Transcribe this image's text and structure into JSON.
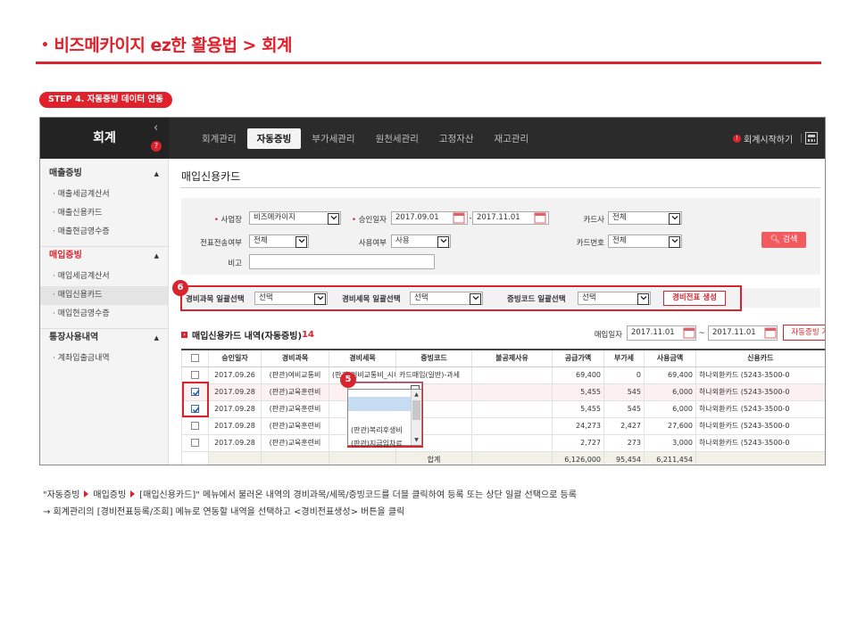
{
  "page": {
    "title": "비즈메카이지 ez한 활용법 > 회계",
    "bullet": "•",
    "step": "STEP 4.  자동증빙 데이터 연동"
  },
  "app": {
    "brand": "회계",
    "menu": [
      "회계관리",
      "자동증빙",
      "부가세관리",
      "원천세관리",
      "고정자산",
      "재고관리"
    ],
    "active_menu": 1,
    "start_label": "회계시작하기"
  },
  "sidebar": {
    "groups": [
      {
        "title": "매출증빙",
        "items": [
          "매출세금계산서",
          "매출신용카드",
          "매출현금영수증"
        ]
      },
      {
        "title": "매입증빙",
        "items": [
          "매입세금계산서",
          "매입신용카드",
          "매입현금영수증"
        ]
      },
      {
        "title": "통장사용내역",
        "items": [
          "계좌입출금내역"
        ]
      }
    ],
    "active_group": 1,
    "active_item": "매입신용카드"
  },
  "main": {
    "title": "매입신용카드",
    "filter": {
      "business_label": "사업장",
      "business_value": "비즈메카이지",
      "approval_label": "승인일자",
      "approval_from": "2017.09.01",
      "approval_to": "2017.11.01",
      "tilde": "-",
      "card_co_label": "카드사",
      "card_co_value": "전체",
      "transfer_label": "전표전송여부",
      "transfer_value": "전체",
      "use_label": "사용여부",
      "use_value": "사용",
      "card_no_label": "카드번호",
      "card_no_value": "전체",
      "memo_label": "비고",
      "memo_value": "",
      "search_button": "검색"
    },
    "bulk": {
      "account_label": "경비과목 일괄선택",
      "account_value": "선택",
      "detail_label": "경비세목 일괄선택",
      "detail_value": "선택",
      "evidence_label": "증빙코드 일괄선택",
      "evidence_value": "선택",
      "create_button": "경비전표 생성"
    },
    "list": {
      "title": "매입신용카드 내역(자동증빙)",
      "count": "14",
      "date_label": "매입일자",
      "date_from": "2017.11.01",
      "date_to": "2017.11.01",
      "tilde": "~",
      "fetch_button": "자동증빙 가져오기"
    },
    "table": {
      "columns": [
        "",
        "승인일자",
        "경비과목",
        "경비세목",
        "증빙코드",
        "불공제사유",
        "공급가액",
        "부가세",
        "사용금액",
        "신용카드"
      ],
      "rows": [
        {
          "checked": false,
          "date": "2017.09.26",
          "account": "(판관)여비교통비",
          "detail": "(판관)여비교통비_시내",
          "evidence": "카드매입(일반)-과세",
          "reason": "",
          "supply": "69,400",
          "vat": "0",
          "amount": "69,400",
          "card": "하나외환카드 (5243-3500-0"
        },
        {
          "checked": true,
          "date": "2017.09.28",
          "account": "(판관)교육훈련비",
          "detail": "",
          "evidence": "",
          "reason": "",
          "supply": "5,455",
          "vat": "545",
          "amount": "6,000",
          "card": "하나외환카드 (5243-3500-0"
        },
        {
          "checked": true,
          "date": "2017.09.28",
          "account": "(판관)교육훈련비",
          "detail": "",
          "evidence": "",
          "reason": "",
          "supply": "5,455",
          "vat": "545",
          "amount": "6,000",
          "card": "하나외환카드 (5243-3500-0"
        },
        {
          "checked": false,
          "date": "2017.09.28",
          "account": "(판관)교육훈련비",
          "detail": "",
          "evidence": "",
          "reason": "",
          "supply": "24,273",
          "vat": "2,427",
          "amount": "27,600",
          "card": "하나외환카드 (5243-3500-0"
        },
        {
          "checked": false,
          "date": "2017.09.28",
          "account": "(판관)교육훈련비",
          "detail": "",
          "evidence": "",
          "reason": "",
          "supply": "2,727",
          "vat": "273",
          "amount": "3,000",
          "card": "하나외환카드 (5243-3500-0"
        }
      ],
      "total_label": "합계",
      "total_supply": "6,126,000",
      "total_vat": "95,454",
      "total_amount": "6,211,454"
    },
    "dropdown_options": [
      "",
      "",
      "(판관)복리후생비",
      "(판관)지급임차료"
    ]
  },
  "callouts": {
    "five": "5",
    "six": "6"
  },
  "notes": {
    "line1_parts": [
      "\"자동증빙",
      "매입증빙",
      "[매입신용카드]\" 메뉴에서 불러온 내역의 경비과목/세목/증빙코드를 더블 클릭하여 등록 또는 상단 일괄 선택으로 등록"
    ],
    "line2": "→  회계관리의 [경비전표등록/조회] 메뉴로 연동할 내역을 선택하고 <경비전표생성> 버튼을 클릭"
  },
  "colors": {
    "accent": "#d9232d",
    "topbar": "#2b2b2b",
    "search_button": "#f15a5f"
  }
}
